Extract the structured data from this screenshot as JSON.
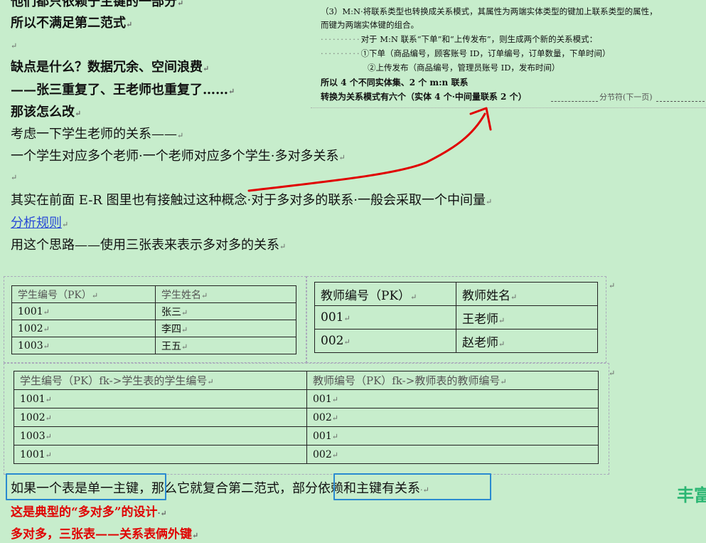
{
  "text": {
    "line0": "他们都只依赖于主键的一部分",
    "line1": "所以不满足第二范式",
    "line2": "缺点是什么？数据冗余、空间浪费",
    "line3": "——张三重复了、王老师也重复了……",
    "line4": "那该怎么改",
    "line5": "考虑一下学生老师的关系——",
    "line6": "一个学生对应多个老师·一个老师对应多个学生·多对多关系",
    "line7": "其实在前面 E-R 图里也有接触过这种概念·对于多对多的联系·一般会采取一个中间量",
    "link": "分析规则",
    "line8": "用这个思路——使用三张表来表示多对多的关系",
    "bottom_box1": "如果一个表是单一主键",
    "bottom_mid": "，那么它就复合第二范式，",
    "bottom_box2": "部分依赖和主键有关系",
    "red1": "这是典型的“多对多”的设计",
    "red2": "多对多，三张表——关系表俩外键",
    "watermark": "丰富"
  },
  "snippet": {
    "s1": "（3）M:N·将联系类型也转换成关系模式，其属性为两端实体类型的键加上联系类型的属性，",
    "s2": "而键为两端实体键的组合。",
    "s3": "对于 M:N 联系“下单”和“上传发布”，则生成两个新的关系模式：",
    "s4": "①下单（商品编号，顾客账号 ID，订单编号，订单数量，下单时间）",
    "s5": "②上传发布（商品编号，管理员账号 ID，发布时间）",
    "s6": "所以 4 个不同实体集、2 个 m:n 联系",
    "s7": "转换为关系模式有六个（实体 4 个·中间量联系 2 个）",
    "s8": "分节符(下一页)"
  },
  "table_students": {
    "headers": [
      "学生编号（PK）",
      "学生姓名"
    ],
    "rows": [
      [
        "1001",
        "张三"
      ],
      [
        "1002",
        "李四"
      ],
      [
        "1003",
        "王五"
      ]
    ]
  },
  "table_teachers": {
    "headers": [
      "教师编号（PK）",
      "教师姓名"
    ],
    "rows": [
      [
        "001",
        "王老师"
      ],
      [
        "002",
        "赵老师"
      ]
    ]
  },
  "table_link": {
    "headers": [
      "学生编号（PK）fk->学生表的学生编号",
      "教师编号（PK）fk->教师表的教师编号"
    ],
    "rows": [
      [
        "1001",
        "001"
      ],
      [
        "1002",
        "002"
      ],
      [
        "1003",
        "001"
      ],
      [
        "1001",
        "002"
      ]
    ]
  },
  "colors": {
    "background": "#c7edcc",
    "red": "#e00000",
    "highlight": "#2a8ad0",
    "link": "#2a4bd7",
    "watermark": "#2bb673"
  }
}
